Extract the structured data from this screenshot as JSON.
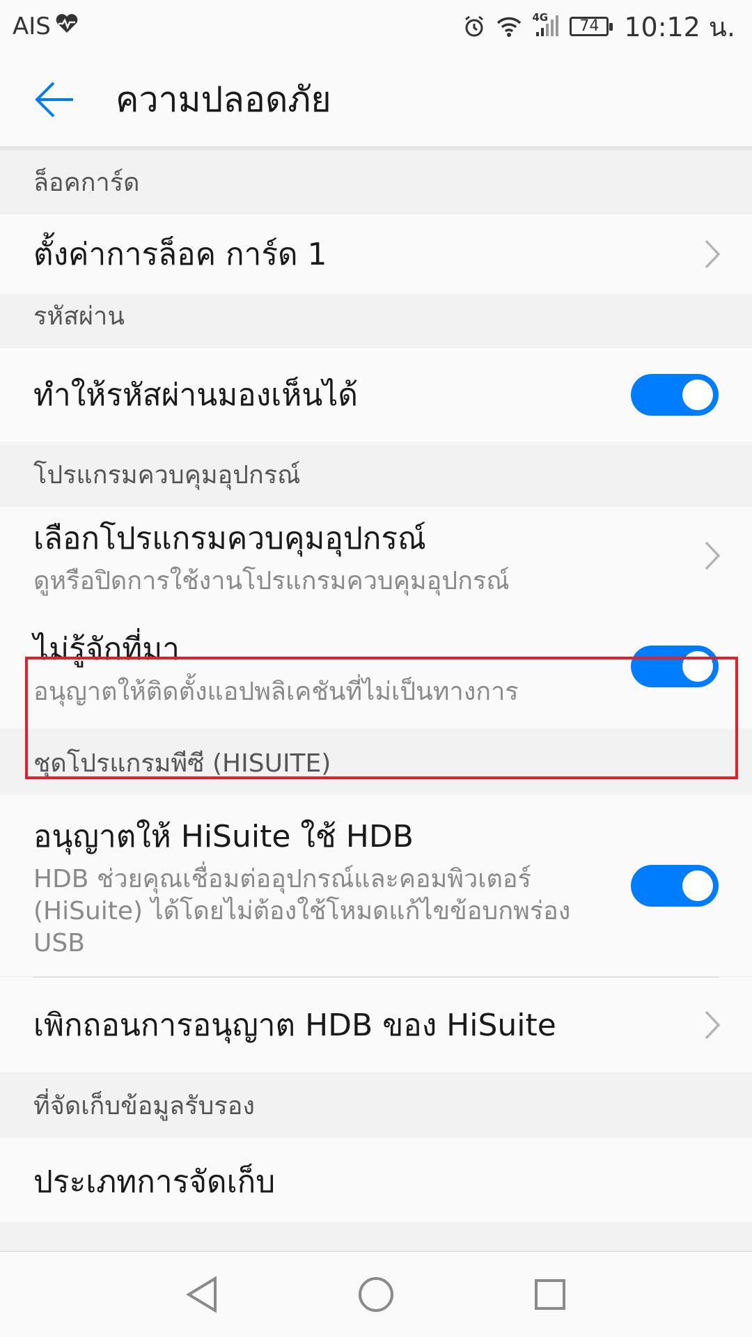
{
  "status_bar": {
    "carrier": "AIS",
    "network": "4G",
    "battery": "74",
    "time": "10:12 น."
  },
  "app_bar": {
    "title": "ความปลอดภัย"
  },
  "sections": {
    "card_lock": {
      "header": "ล็อคการ์ด",
      "items": [
        {
          "title": "ตั้งค่าการล็อค การ์ด 1"
        }
      ]
    },
    "password": {
      "header": "รหัสผ่าน",
      "items": [
        {
          "title": "ทำให้รหัสผ่านมองเห็นได้",
          "toggle": "on"
        }
      ]
    },
    "device_admin": {
      "header": "โปรแกรมควบคุมอุปกรณ์",
      "items": [
        {
          "title": "เลือกโปรแกรมควบคุมอุปกรณ์",
          "subtitle": "ดูหรือปิดการใช้งานโปรแกรมควบคุมอุปกรณ์"
        },
        {
          "title": "ไม่รู้จักที่มา",
          "subtitle": "อนุญาตให้ติดตั้งแอปพลิเคชันที่ไม่เป็นทางการ",
          "toggle": "on"
        }
      ]
    },
    "hisuite": {
      "header": "ชุดโปรแกรมพีซี (HISUITE)",
      "items": [
        {
          "title": "อนุญาตให้ HiSuite ใช้ HDB",
          "subtitle": "HDB ช่วยคุณเชื่อมต่ออุปกรณ์และคอมพิวเตอร์ (HiSuite) ได้โดยไม่ต้องใช้โหมดแก้ไขข้อบกพร่อง USB",
          "toggle": "on"
        },
        {
          "title": "เพิกถอนการอนุญาต HDB ของ HiSuite"
        }
      ]
    },
    "credential_storage": {
      "header": "ที่จัดเก็บข้อมูลรับรอง",
      "items": [
        {
          "title": "ประเภทการจัดเก็บ"
        }
      ]
    }
  },
  "colors": {
    "accent": "#007dff",
    "highlight": "#e0202b"
  }
}
